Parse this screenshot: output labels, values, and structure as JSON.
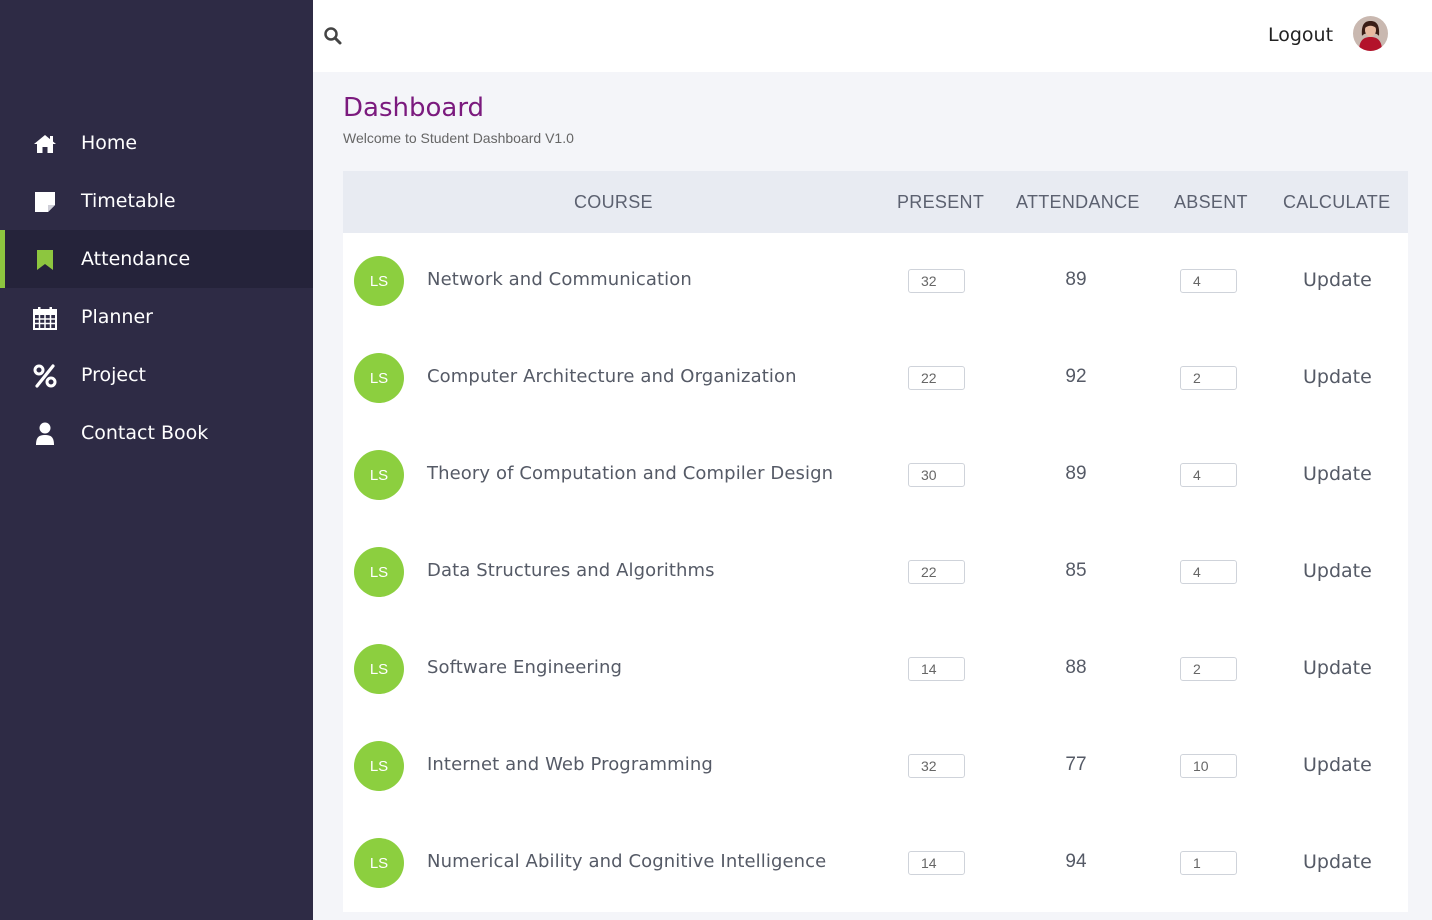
{
  "sidebar": {
    "items": [
      {
        "label": "Home",
        "icon": "home-icon"
      },
      {
        "label": "Timetable",
        "icon": "note-icon"
      },
      {
        "label": "Attendance",
        "icon": "bookmark-icon",
        "active": true
      },
      {
        "label": "Planner",
        "icon": "calendar-icon"
      },
      {
        "label": "Project",
        "icon": "percent-icon"
      },
      {
        "label": "Contact Book",
        "icon": "user-icon"
      }
    ]
  },
  "topbar": {
    "logout_label": "Logout"
  },
  "page": {
    "title": "Dashboard",
    "subtitle": "Welcome to Student Dashboard V1.0"
  },
  "table": {
    "headers": {
      "course": "COURSE",
      "present": "PRESENT",
      "attendance": "ATTENDANCE",
      "absent": "ABSENT",
      "calculate": "CALCULATE"
    },
    "rows": [
      {
        "badge": "LS",
        "course": "Network and Communication",
        "present": "32",
        "attendance": "89",
        "absent": "4",
        "action": "Update"
      },
      {
        "badge": "LS",
        "course": "Computer Architecture and Organization",
        "present": "22",
        "attendance": "92",
        "absent": "2",
        "action": "Update"
      },
      {
        "badge": "LS",
        "course": "Theory of Computation and Compiler Design",
        "present": "30",
        "attendance": "89",
        "absent": "4",
        "action": "Update"
      },
      {
        "badge": "LS",
        "course": "Data Structures and Algorithms",
        "present": "22",
        "attendance": "85",
        "absent": "4",
        "action": "Update"
      },
      {
        "badge": "LS",
        "course": "Software Engineering",
        "present": "14",
        "attendance": "88",
        "absent": "2",
        "action": "Update"
      },
      {
        "badge": "LS",
        "course": "Internet and Web Programming",
        "present": "32",
        "attendance": "77",
        "absent": "10",
        "action": "Update"
      },
      {
        "badge": "LS",
        "course": "Numerical Ability and Cognitive Intelligence",
        "present": "14",
        "attendance": "94",
        "absent": "1",
        "action": "Update"
      }
    ]
  },
  "colors": {
    "sidebar_bg": "#2e2b45",
    "accent_green": "#8ccf3f",
    "title_purple": "#7b1a7e"
  }
}
